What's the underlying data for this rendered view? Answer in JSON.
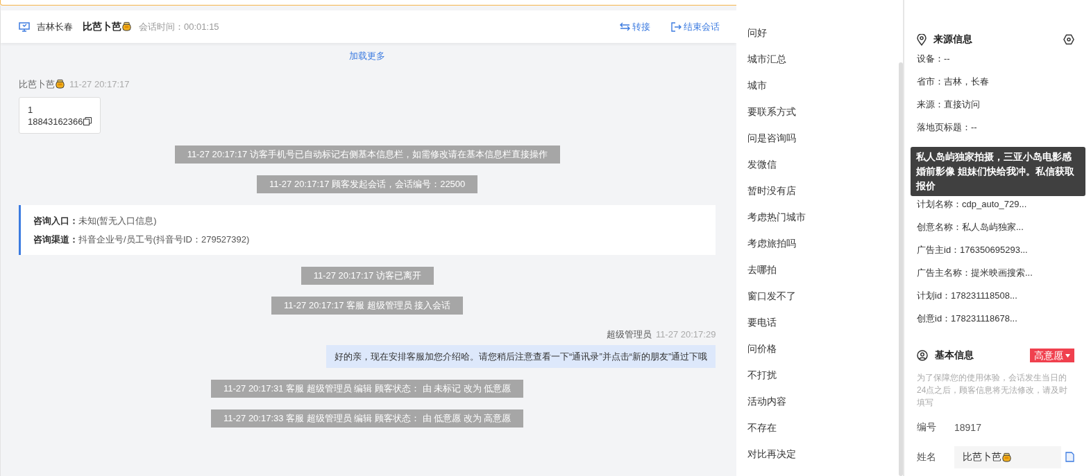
{
  "header": {
    "location": "吉林长春",
    "visitor": "比芭卜芭",
    "duration": "会话时间：00:01:15",
    "actions": [
      {
        "kind": "transfer",
        "label": "转接"
      },
      {
        "kind": "end",
        "label": "结束会话"
      }
    ]
  },
  "load_more": "加载更多",
  "messages": [
    {
      "kind": "visitor",
      "sender": "比芭卜芭",
      "time": "11-27 20:17:17",
      "lines": [
        "1",
        "18843162366"
      ]
    },
    {
      "kind": "system",
      "text": "11-27 20:17:17 访客手机号已自动标记右侧基本信息栏，如需修改请在基本信息栏直接操作"
    },
    {
      "kind": "system",
      "text": "11-27 20:17:17 顾客发起会话，会话编号：22500"
    },
    {
      "kind": "source",
      "rows": [
        {
          "label": "咨询入口：",
          "value": "未知(暂无入口信息)"
        },
        {
          "label": "咨询渠道：",
          "value": "抖音企业号/员工号(抖音号ID：279527392)"
        }
      ]
    },
    {
      "kind": "system",
      "text": "11-27 20:17:17 访客已离开"
    },
    {
      "kind": "system",
      "text": "11-27 20:17:17 客服 超级管理员 接入会话"
    },
    {
      "kind": "agent",
      "sender": "超级管理员",
      "time": "11-27 20:17:29",
      "text": "好的亲，现在安排客服加您介绍哈。请您稍后注意查看一下“通讯录”并点击“新的朋友”通过下哦"
    },
    {
      "kind": "system",
      "text": "11-27 20:17:31 客服 超级管理员 编辑 顾客状态： 由 未标记 改为 低意愿"
    },
    {
      "kind": "system",
      "text": "11-27 20:17:33 客服 超级管理员 编辑 顾客状态： 由 低意愿 改为 高意愿"
    }
  ],
  "quick_replies": [
    "问好",
    "城市汇总",
    "城市",
    "要联系方式",
    "问是咨询吗",
    "发微信",
    "暂时没有店",
    "考虑热门城市",
    "考虑旅拍吗",
    "去哪拍",
    "窗口发不了",
    "要电话",
    "问价格",
    "不打扰",
    "活动内容",
    "不存在",
    "对比再决定"
  ],
  "source_info": {
    "title": "来源信息",
    "items": [
      "设备：--",
      "省市：吉林，长春",
      "来源：直接访问",
      "落地页标题：--",
      "计划名称：cdp_auto_729...",
      "创意名称：私人岛屿独家...",
      "广告主id：176350695293...",
      "广告主名称：提米映画搜索...",
      "计划id：178231118508...",
      "创意id：178231118678..."
    ]
  },
  "tooltip": "私人岛屿独家拍摄，三亚小岛电影感婚前影像 姐妹们快给我冲。私信获取报价",
  "basic_info": {
    "title": "基本信息",
    "intent": "高意愿",
    "notice": "为了保障您的使用体验，会话发生当日的24点之后，顾客信息将无法修改，请及时填写",
    "fields": [
      {
        "kind": "text",
        "label": "编号",
        "value": "18917"
      },
      {
        "kind": "input",
        "label": "姓名",
        "value": "比芭卜芭"
      }
    ]
  }
}
